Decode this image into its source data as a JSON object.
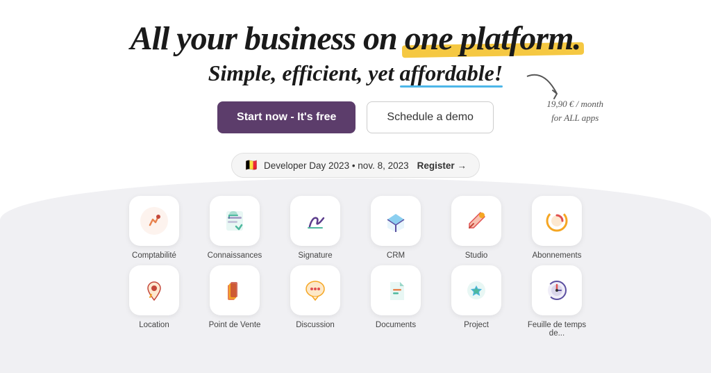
{
  "hero": {
    "heading_start": "All your business on ",
    "heading_highlight": "one platform.",
    "subheading_start": "Simple, efficient, yet ",
    "subheading_highlight": "affordable!",
    "price_note": "19,90 € / month\nfor ALL apps",
    "cta_primary": "Start now - It's free",
    "cta_secondary": "Schedule a demo"
  },
  "banner": {
    "flag": "🇧🇪",
    "event_text": "Developer Day 2023 • nov. 8, 2023",
    "register_label": "Register →"
  },
  "apps_row1": [
    {
      "id": "comptabilite",
      "label": "Comptabilité",
      "color1": "#e8834f",
      "color2": "#c4473a"
    },
    {
      "id": "connaissances",
      "label": "Connaissances",
      "color1": "#4db89e",
      "color2": "#6c4fa0"
    },
    {
      "id": "signature",
      "label": "Signature",
      "color1": "#5c3d8c",
      "color2": "#4db89e"
    },
    {
      "id": "crm",
      "label": "CRM",
      "color1": "#4db6e8",
      "color2": "#5b4fa0"
    },
    {
      "id": "studio",
      "label": "Studio",
      "color1": "#e05050",
      "color2": "#f5a623"
    },
    {
      "id": "abonnements",
      "label": "Abonnements",
      "color1": "#f5a623",
      "color2": "#e05050"
    }
  ],
  "apps_row2": [
    {
      "id": "location",
      "label": "Location",
      "color1": "#c4473a",
      "color2": "#f5a623"
    },
    {
      "id": "point-de-vente",
      "label": "Point de Vente",
      "color1": "#e8834f",
      "color2": "#c4473a"
    },
    {
      "id": "discussion",
      "label": "Discussion",
      "color1": "#f5a623",
      "color2": "#e05050"
    },
    {
      "id": "documents",
      "label": "Documents",
      "color1": "#4db89e",
      "color2": "#e8834f"
    },
    {
      "id": "project",
      "label": "Project",
      "color1": "#4db89e",
      "color2": "#4db6e8"
    },
    {
      "id": "feuille-temps",
      "label": "Feuille de temps de...",
      "color1": "#5b4fa0",
      "color2": "#e05050"
    }
  ]
}
